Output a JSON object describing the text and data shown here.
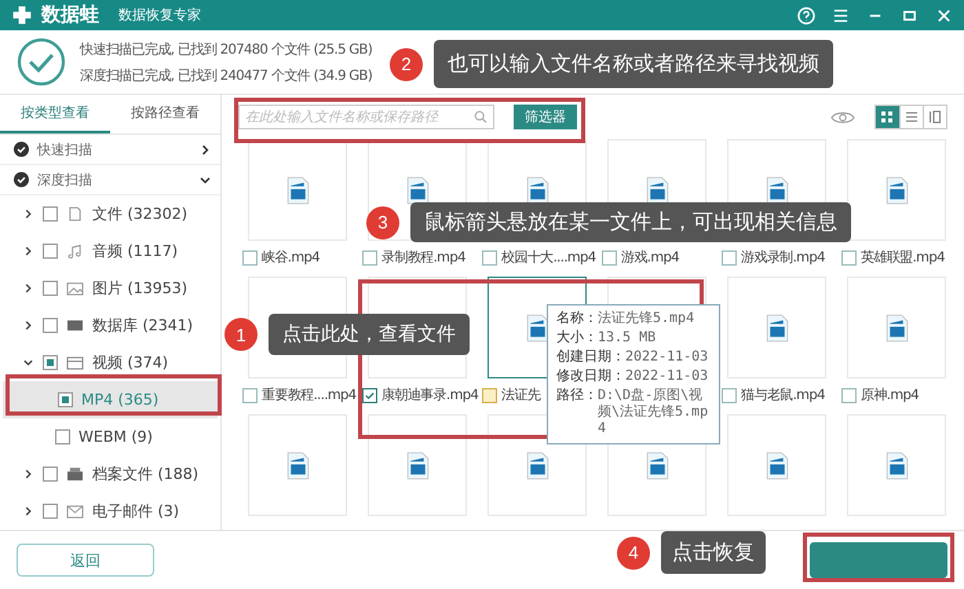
{
  "app": {
    "name": "数据蛙",
    "tagline": "数据恢复专家"
  },
  "scan_summary": [
    "快速扫描已完成, 已找到 207480 个文件 (25.5 GB)",
    "深度扫描已完成, 已找到 240477 个文件 (34.9 GB)"
  ],
  "view_tabs": [
    {
      "label": "按类型查看",
      "selected": true
    },
    {
      "label": "按路径查看",
      "selected": false
    }
  ],
  "scan_sections": [
    {
      "label": "快速扫描",
      "expanded": false
    },
    {
      "label": "深度扫描",
      "expanded": true
    }
  ],
  "tree": [
    {
      "kind": "document",
      "label": "文件 (32302)",
      "checked": false,
      "expanded": false
    },
    {
      "kind": "audio",
      "label": "音频 (1117)",
      "checked": false,
      "expanded": false
    },
    {
      "kind": "image",
      "label": "图片 (13953)",
      "checked": false,
      "expanded": false
    },
    {
      "kind": "database",
      "label": "数据库 (2341)",
      "checked": false,
      "expanded": false
    },
    {
      "kind": "video",
      "label": "视频 (374)",
      "checked": true,
      "expanded": true,
      "children": [
        {
          "label": "MP4 (365)",
          "checked": true,
          "selected": true
        },
        {
          "label": "WEBM (9)",
          "checked": false,
          "selected": false
        }
      ]
    },
    {
      "kind": "archive",
      "label": "档案文件 (188)",
      "checked": false,
      "expanded": false
    },
    {
      "kind": "email",
      "label": "电子邮件 (3)",
      "checked": false,
      "expanded": false
    }
  ],
  "search": {
    "placeholder": "在此处输入文件名称或保存路径"
  },
  "filter_button": "筛选器",
  "view_modes": [
    {
      "kind": "grid",
      "selected": true
    },
    {
      "kind": "list",
      "selected": false
    },
    {
      "kind": "detail",
      "selected": false
    }
  ],
  "files": [
    {
      "label": "峡谷.mp4",
      "checked": false,
      "hovered": false
    },
    {
      "label": "录制教程.mp4",
      "checked": false,
      "hovered": false
    },
    {
      "label": "校园十大....mp4",
      "checked": false,
      "hovered": false
    },
    {
      "label": "游戏.mp4",
      "checked": false,
      "hovered": false
    },
    {
      "label": "游戏录制.mp4",
      "checked": false,
      "hovered": false
    },
    {
      "label": "英雄联盟.mp4",
      "checked": false,
      "hovered": false
    },
    {
      "label": "重要教程....mp4",
      "checked": false,
      "hovered": false
    },
    {
      "label": "康朝迪事录.mp4",
      "checked": true,
      "hovered": false
    },
    {
      "label": "法证先",
      "checked": false,
      "hovered": true
    },
    {
      "hovered": false
    },
    {
      "label": "猫与老鼠.mp4",
      "checked": false,
      "hovered": false
    },
    {
      "label": "原神.mp4",
      "checked": false,
      "hovered": false
    },
    {
      "hovered": false
    },
    {
      "hovered": false
    },
    {
      "hovered": false
    },
    {
      "hovered": false
    },
    {
      "hovered": false
    },
    {
      "hovered": false
    }
  ],
  "file_info": [
    {
      "label": "名称：",
      "value": "法证先锋5.mp4"
    },
    {
      "label": "大小：",
      "value": "13.5 MB"
    },
    {
      "label": "创建日期：",
      "value": "2022-11-03"
    },
    {
      "label": "修改日期：",
      "value": "2022-11-03"
    },
    {
      "label": "路径：",
      "value": "D:\\D盘-原图\\视频\\法证先锋5.mp4"
    }
  ],
  "back_button": "返回",
  "annotations": [
    {
      "number": "1",
      "text": "点击此处，查看文件"
    },
    {
      "number": "2",
      "text": "也可以输入文件名称或者路径来寻找视频"
    },
    {
      "number": "3",
      "text": "鼠标箭头悬放在某一文件上，可出现相关信息"
    },
    {
      "number": "4",
      "text": "点击恢复"
    }
  ]
}
